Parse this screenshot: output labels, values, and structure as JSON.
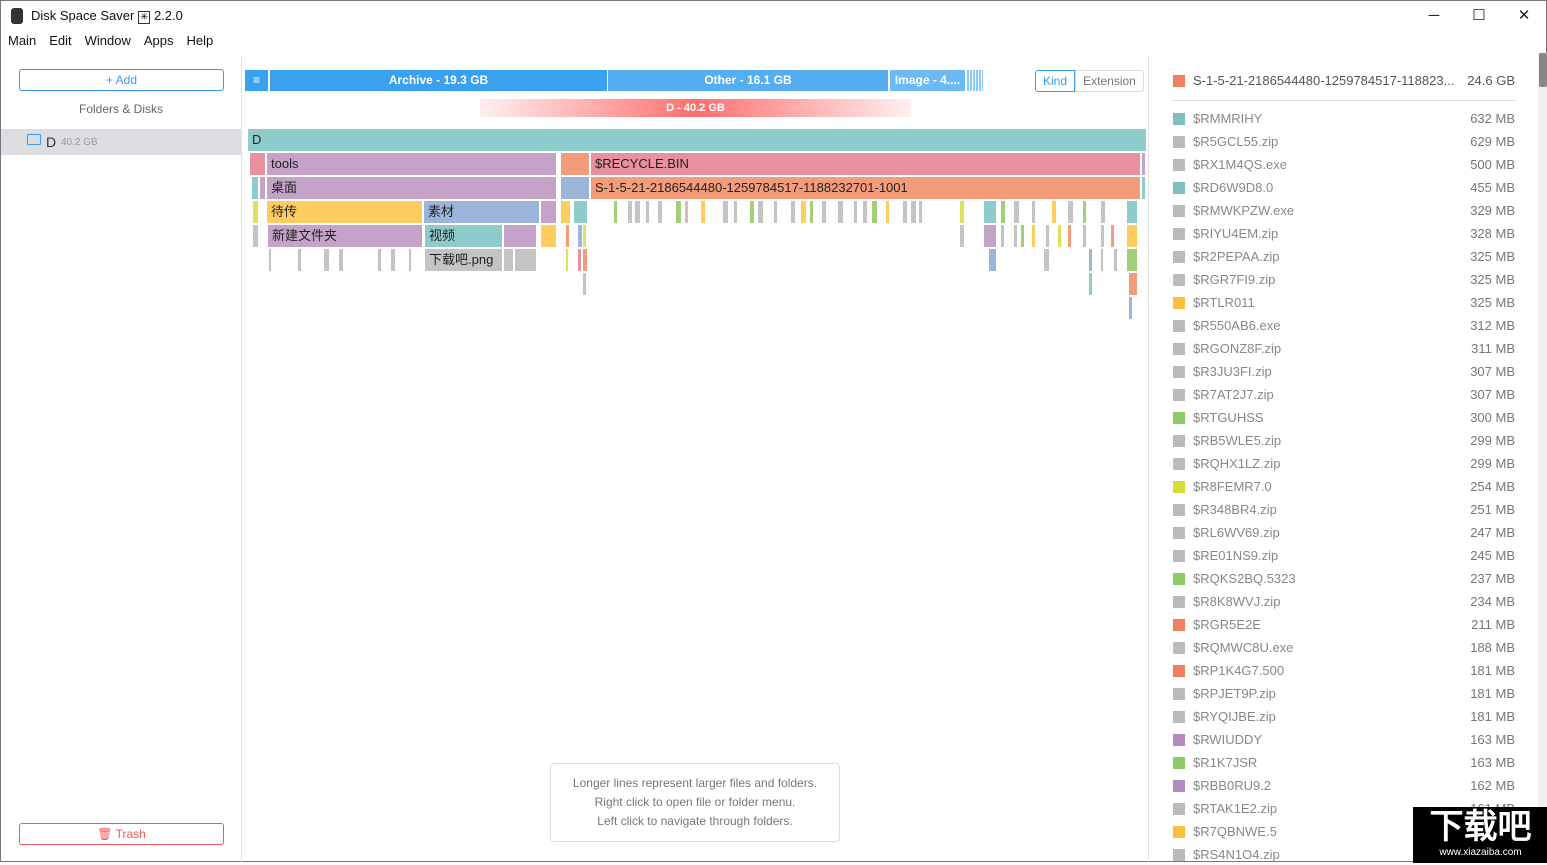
{
  "window": {
    "title": "Disk Space Saver",
    "version": "2.2.0",
    "minimize": "─",
    "maximize": "☐",
    "close": "✕"
  },
  "menu": [
    "Main",
    "Edit",
    "Window",
    "Apps",
    "Help"
  ],
  "sidebar": {
    "add_label": "+ Add",
    "section_title": "Folders & Disks",
    "disks": [
      {
        "name": "D",
        "size": "40.2 GB"
      }
    ],
    "trash_label": "Trash"
  },
  "kind_bar": {
    "menu_icon": "≡",
    "segments": [
      {
        "label": "Archive - 19.3 GB",
        "color": "#3aa0f0"
      },
      {
        "label": "Other - 16.1 GB",
        "color": "#55aef2"
      },
      {
        "label": "Image - 4....",
        "color": "#6cb9f4"
      }
    ]
  },
  "view_toggle": {
    "options": [
      "Kind",
      "Extension"
    ],
    "selected": "Kind"
  },
  "disk_bar": {
    "label": "D - 40.2 GB",
    "color": "#fd6f6f"
  },
  "tree": {
    "root": "D",
    "tools": "tools",
    "recycle": "$RECYCLE.BIN",
    "desktop": "桌面",
    "sid": "S-1-5-21-2186544480-1259784517-1188232701-1001",
    "upload": "待传",
    "material": "素材",
    "newfolder": "新建文件夹",
    "video": "视频",
    "png": "下载吧.png"
  },
  "colors": {
    "teal": "#8ecbcb",
    "purple": "#c5a3c9",
    "pink": "#e8909d",
    "orange": "#f49c7a",
    "blue": "#9db4db",
    "yellow": "#fecd5f",
    "gray": "#c4c4c4",
    "green": "#a4cf7a",
    "lime": "#dde25a"
  },
  "hint": [
    "Longer lines represent larger files and folders.",
    "Right click to open file or folder menu.",
    "Left click to navigate through folders."
  ],
  "list_header": {
    "name": "S-1-5-21-2186544480-1259784517-118823...",
    "size": "24.6 GB",
    "color": "#f08060"
  },
  "list": [
    {
      "name": "$RMMRIHY",
      "size": "632 MB",
      "color": "#7cc0c0"
    },
    {
      "name": "$R5GCL55.zip",
      "size": "629 MB",
      "color": "#bbbbbb"
    },
    {
      "name": "$RX1M4QS.exe",
      "size": "500 MB",
      "color": "#bbbbbb"
    },
    {
      "name": "$RD6W9D8.0",
      "size": "455 MB",
      "color": "#7cc0c0"
    },
    {
      "name": "$RMWKPZW.exe",
      "size": "329 MB",
      "color": "#bbbbbb"
    },
    {
      "name": "$RIYU4EM.zip",
      "size": "328 MB",
      "color": "#bbbbbb"
    },
    {
      "name": "$R2PEPAA.zip",
      "size": "325 MB",
      "color": "#bbbbbb"
    },
    {
      "name": "$RGR7FI9.zip",
      "size": "325 MB",
      "color": "#bbbbbb"
    },
    {
      "name": "$RTLR011",
      "size": "325 MB",
      "color": "#fdbf3c"
    },
    {
      "name": "$R550AB6.exe",
      "size": "312 MB",
      "color": "#bbbbbb"
    },
    {
      "name": "$RGONZ8F.zip",
      "size": "311 MB",
      "color": "#bbbbbb"
    },
    {
      "name": "$R3JU3FI.zip",
      "size": "307 MB",
      "color": "#bbbbbb"
    },
    {
      "name": "$R7AT2J7.zip",
      "size": "307 MB",
      "color": "#bbbbbb"
    },
    {
      "name": "$RTGUHSS",
      "size": "300 MB",
      "color": "#8dca6a"
    },
    {
      "name": "$RB5WLE5.zip",
      "size": "299 MB",
      "color": "#bbbbbb"
    },
    {
      "name": "$RQHX1LZ.zip",
      "size": "299 MB",
      "color": "#bbbbbb"
    },
    {
      "name": "$R8FEMR7.0",
      "size": "254 MB",
      "color": "#d8dc3a"
    },
    {
      "name": "$R348BR4.zip",
      "size": "251 MB",
      "color": "#bbbbbb"
    },
    {
      "name": "$RL6WV69.zip",
      "size": "247 MB",
      "color": "#bbbbbb"
    },
    {
      "name": "$RE01NS9.zip",
      "size": "245 MB",
      "color": "#bbbbbb"
    },
    {
      "name": "$RQKS2BQ.5323",
      "size": "237 MB",
      "color": "#8dca6a"
    },
    {
      "name": "$R8K8WVJ.zip",
      "size": "234 MB",
      "color": "#bbbbbb"
    },
    {
      "name": "$RGR5E2E",
      "size": "211 MB",
      "color": "#f08060"
    },
    {
      "name": "$RQMWC8U.exe",
      "size": "188 MB",
      "color": "#bbbbbb"
    },
    {
      "name": "$RP1K4G7.500",
      "size": "181 MB",
      "color": "#f08060"
    },
    {
      "name": "$RPJET9P.zip",
      "size": "181 MB",
      "color": "#bbbbbb"
    },
    {
      "name": "$RYQIJBE.zip",
      "size": "181 MB",
      "color": "#bbbbbb"
    },
    {
      "name": "$RWIUDDY",
      "size": "163 MB",
      "color": "#b48ac0"
    },
    {
      "name": "$R1K7JSR",
      "size": "163 MB",
      "color": "#8dca6a"
    },
    {
      "name": "$RBB0RU9.2",
      "size": "162 MB",
      "color": "#b48ac0"
    },
    {
      "name": "$RTAK1E2.zip",
      "size": "161 MB",
      "color": "#bbbbbb"
    },
    {
      "name": "$R7QBNWE.5",
      "size": "",
      "color": "#fdbf3c"
    },
    {
      "name": "$RS4N1O4.zip",
      "size": "",
      "color": "#bbbbbb"
    }
  ],
  "watermark": {
    "logo": "下载吧",
    "url": "www.xiazaiba.com"
  }
}
